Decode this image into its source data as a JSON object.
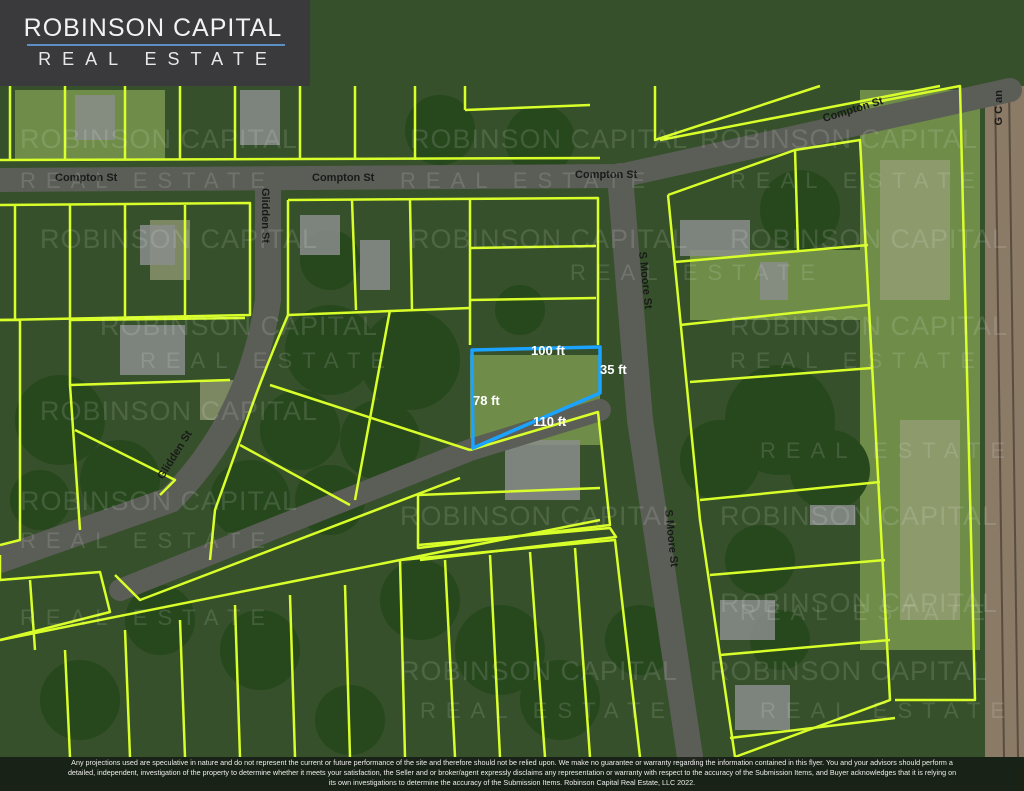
{
  "logo": {
    "line1": "ROBINSON CAPITAL",
    "line2": "REAL ESTATE"
  },
  "watermark": {
    "line1": "ROBINSON CAPITAL",
    "line2": "REAL ESTATE"
  },
  "streets": {
    "compton_left": "Compton St",
    "compton_mid": "Compton St",
    "compton_right": "Compton St",
    "compton_far": "Compton St",
    "glidden_top": "Glidden St",
    "glidden_bottom": "Glidden St",
    "moore_top": "S Moore St",
    "moore_bottom": "S Moore St",
    "rail": "G C an"
  },
  "subject_lot": {
    "top": "100 ft",
    "right": "35 ft",
    "left": "78 ft",
    "bottom": "110 ft"
  },
  "colors": {
    "parcel_line": "#d9ff2a",
    "subject_outline": "#1aa3ff",
    "road": "#5b5d57",
    "tree_canopy": "#2f5a24",
    "grass": "#6b8a45"
  },
  "disclaimer": {
    "line1": "Any projections used are speculative in nature and do not represent the current or future performance of the site and therefore should not be relied upon. We make no guarantee or warranty regarding the information contained in this flyer. You and your advisors should perform a",
    "line2": "detailed, independent, investigation of the property to determine whether it meets your satisfaction, the Seller and or broker/agent expressly disclaims any representation or warranty with respect to the accuracy of the Submission Items, and Buyer acknowledges that it is relying on",
    "line3": "its own investigations to determine the accuracy of the Submission Items. Robinson Capital Real Estate, LLC 2022."
  }
}
